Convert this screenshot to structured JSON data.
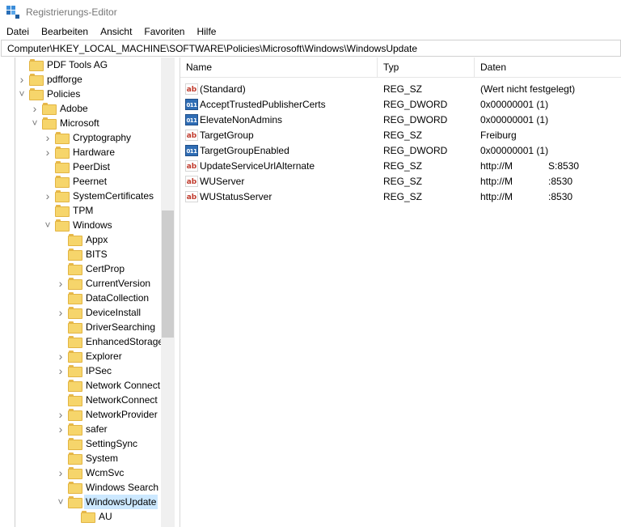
{
  "window": {
    "title": "Registrierungs-Editor"
  },
  "menu": [
    "Datei",
    "Bearbeiten",
    "Ansicht",
    "Favoriten",
    "Hilfe"
  ],
  "address": "Computer\\HKEY_LOCAL_MACHINE\\SOFTWARE\\Policies\\Microsoft\\Windows\\WindowsUpdate",
  "tree": [
    {
      "label": "PDF Tools AG",
      "indent": 0,
      "chevron": ""
    },
    {
      "label": "pdfforge",
      "indent": 0,
      "chevron": "right"
    },
    {
      "label": "Policies",
      "indent": 0,
      "chevron": "down"
    },
    {
      "label": "Adobe",
      "indent": 1,
      "chevron": "right"
    },
    {
      "label": "Microsoft",
      "indent": 1,
      "chevron": "down"
    },
    {
      "label": "Cryptography",
      "indent": 2,
      "chevron": "right"
    },
    {
      "label": "Hardware",
      "indent": 2,
      "chevron": "right"
    },
    {
      "label": "PeerDist",
      "indent": 2,
      "chevron": ""
    },
    {
      "label": "Peernet",
      "indent": 2,
      "chevron": ""
    },
    {
      "label": "SystemCertificates",
      "indent": 2,
      "chevron": "right"
    },
    {
      "label": "TPM",
      "indent": 2,
      "chevron": ""
    },
    {
      "label": "Windows",
      "indent": 2,
      "chevron": "down"
    },
    {
      "label": "Appx",
      "indent": 3,
      "chevron": ""
    },
    {
      "label": "BITS",
      "indent": 3,
      "chevron": ""
    },
    {
      "label": "CertProp",
      "indent": 3,
      "chevron": ""
    },
    {
      "label": "CurrentVersion",
      "indent": 3,
      "chevron": "right"
    },
    {
      "label": "DataCollection",
      "indent": 3,
      "chevron": ""
    },
    {
      "label": "DeviceInstall",
      "indent": 3,
      "chevron": "right"
    },
    {
      "label": "DriverSearching",
      "indent": 3,
      "chevron": ""
    },
    {
      "label": "EnhancedStorage",
      "indent": 3,
      "chevron": ""
    },
    {
      "label": "Explorer",
      "indent": 3,
      "chevron": "right"
    },
    {
      "label": "IPSec",
      "indent": 3,
      "chevron": "right"
    },
    {
      "label": "Network Connect",
      "indent": 3,
      "chevron": ""
    },
    {
      "label": "NetworkConnect",
      "indent": 3,
      "chevron": ""
    },
    {
      "label": "NetworkProvider",
      "indent": 3,
      "chevron": "right"
    },
    {
      "label": "safer",
      "indent": 3,
      "chevron": "right"
    },
    {
      "label": "SettingSync",
      "indent": 3,
      "chevron": ""
    },
    {
      "label": "System",
      "indent": 3,
      "chevron": ""
    },
    {
      "label": "WcmSvc",
      "indent": 3,
      "chevron": "right"
    },
    {
      "label": "Windows Search",
      "indent": 3,
      "chevron": ""
    },
    {
      "label": "WindowsUpdate",
      "indent": 3,
      "chevron": "down",
      "selected": true
    },
    {
      "label": "AU",
      "indent": 4,
      "chevron": ""
    }
  ],
  "columns": {
    "name": "Name",
    "type": "Typ",
    "data": "Daten"
  },
  "values": [
    {
      "icon": "string-value-icon",
      "kind": "sz",
      "name": "(Standard)",
      "type": "REG_SZ",
      "data": "(Wert nicht festgelegt)"
    },
    {
      "icon": "dword-value-icon",
      "kind": "dword",
      "name": "AcceptTrustedPublisherCerts",
      "type": "REG_DWORD",
      "data": "0x00000001 (1)"
    },
    {
      "icon": "dword-value-icon",
      "kind": "dword",
      "name": "ElevateNonAdmins",
      "type": "REG_DWORD",
      "data": "0x00000001 (1)"
    },
    {
      "icon": "string-value-icon",
      "kind": "sz",
      "name": "TargetGroup",
      "type": "REG_SZ",
      "data": "Freiburg"
    },
    {
      "icon": "dword-value-icon",
      "kind": "dword",
      "name": "TargetGroupEnabled",
      "type": "REG_DWORD",
      "data": "0x00000001 (1)"
    },
    {
      "icon": "string-value-icon",
      "kind": "sz",
      "name": "UpdateServiceUrlAlternate",
      "type": "REG_SZ",
      "data": "http://M",
      "data_tail": "S:8530"
    },
    {
      "icon": "string-value-icon",
      "kind": "sz",
      "name": "WUServer",
      "type": "REG_SZ",
      "data": "http://M",
      "data_tail": ":8530"
    },
    {
      "icon": "string-value-icon",
      "kind": "sz",
      "name": "WUStatusServer",
      "type": "REG_SZ",
      "data": "http://M",
      "data_tail": ":8530"
    }
  ]
}
